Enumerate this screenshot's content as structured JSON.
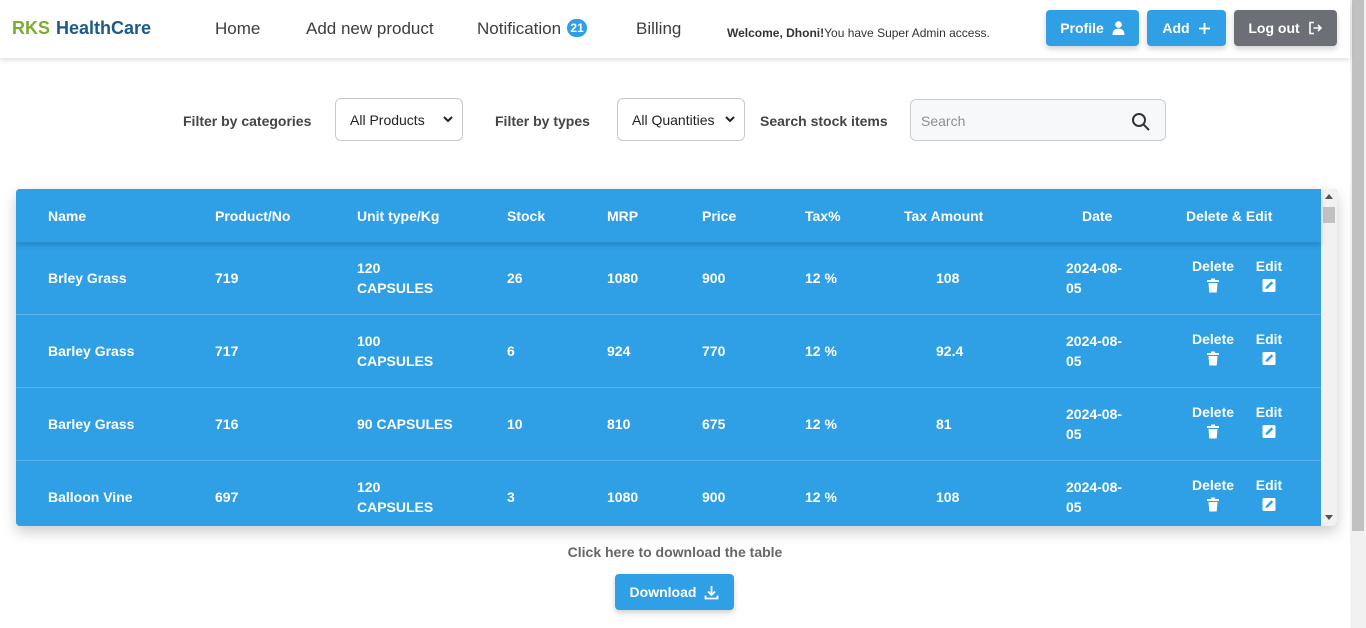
{
  "brand": {
    "part1": "RKS",
    "part2": "HealthCare"
  },
  "nav": {
    "home": "Home",
    "add_product": "Add new product",
    "notification": "Notification",
    "notification_count": "21",
    "billing": "Billing"
  },
  "welcome": {
    "name": "Welcome, Dhoni!",
    "access": "You have Super Admin access."
  },
  "buttons": {
    "profile": "Profile",
    "add": "Add",
    "logout": "Log out",
    "profile_icon": "user-icon",
    "add_icon": "plus-icon",
    "logout_icon": "logout-icon"
  },
  "filters": {
    "category_label": "Filter by categories",
    "category_value": "All Products",
    "type_label": "Filter by types",
    "type_value": "All Quantities",
    "search_label": "Search stock items",
    "search_placeholder": "Search",
    "search_value": ""
  },
  "table": {
    "headers": [
      "Name",
      "Product/No",
      "Unit type/Kg",
      "Stock",
      "MRP",
      "Price",
      "Tax%",
      "Tax Amount",
      "Date",
      "Delete & Edit"
    ],
    "rows": [
      {
        "name": "Brley Grass",
        "product_no": "719",
        "unit_1": "120",
        "unit_2": "CAPSULES",
        "stock": "26",
        "mrp": "1080",
        "price": "900",
        "tax": "12 %",
        "tax_amount": "108",
        "date_1": "2024-08-",
        "date_2": "05"
      },
      {
        "name": "Barley Grass",
        "product_no": "717",
        "unit_1": "100",
        "unit_2": "CAPSULES",
        "stock": "6",
        "mrp": "924",
        "price": "770",
        "tax": "12 %",
        "tax_amount": "92.4",
        "date_1": "2024-08-",
        "date_2": "05"
      },
      {
        "name": "Barley Grass",
        "product_no": "716",
        "unit_1": "90 CAPSULES",
        "unit_2": "",
        "stock": "10",
        "mrp": "810",
        "price": "675",
        "tax": "12 %",
        "tax_amount": "81",
        "date_1": "2024-08-",
        "date_2": "05"
      },
      {
        "name": "Balloon Vine",
        "product_no": "697",
        "unit_1": "120",
        "unit_2": "CAPSULES",
        "stock": "3",
        "mrp": "1080",
        "price": "900",
        "tax": "12 %",
        "tax_amount": "108",
        "date_1": "2024-08-",
        "date_2": "05"
      }
    ],
    "delete_label": "Delete",
    "edit_label": "Edit",
    "delete_icon": "trash-icon",
    "edit_icon": "edit-icon"
  },
  "download": {
    "prompt": "Click here to download the table",
    "button": "Download",
    "icon": "download-icon"
  },
  "colors": {
    "primary": "#2f9fe6",
    "logout": "#6c6f75",
    "brand_green": "#7bad2e",
    "brand_blue": "#1b5a8a"
  }
}
